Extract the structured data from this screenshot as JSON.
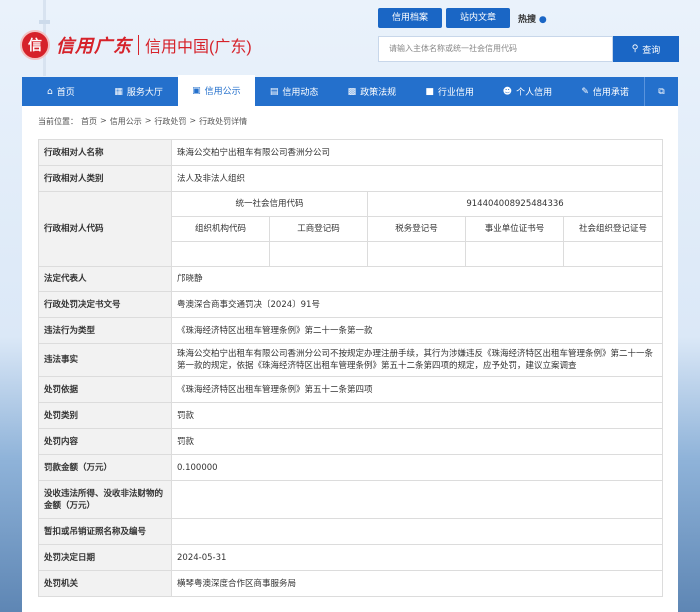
{
  "header": {
    "logo_mark": "信",
    "logo_calligraphy": "信用广东",
    "logo_title": "信用中国(广东)",
    "search_tabs": [
      "信用档案",
      "站内文章"
    ],
    "hotword_label": "热搜",
    "hotword_icon": "flame-icon",
    "search_placeholder": "请输入主体名称或统一社会信用代码",
    "search_button": "查询"
  },
  "nav": {
    "items": [
      {
        "label": "首页",
        "icon": "home-icon"
      },
      {
        "label": "服务大厅",
        "icon": "grid-icon"
      },
      {
        "label": "信用公示",
        "icon": "bag-icon"
      },
      {
        "label": "信用动态",
        "icon": "document-icon"
      },
      {
        "label": "政策法规",
        "icon": "book-icon"
      },
      {
        "label": "行业信用",
        "icon": "briefcase-icon"
      },
      {
        "label": "个人信用",
        "icon": "person-icon"
      },
      {
        "label": "信用承诺",
        "icon": "pen-icon"
      }
    ],
    "active_index": 2,
    "expand_icon": "expand-icon"
  },
  "breadcrumb": {
    "prefix": "当前位置：",
    "items": [
      "首页",
      "信用公示",
      "行政处罚",
      "行政处罚详情"
    ],
    "separator": ">"
  },
  "detail": {
    "name_label": "行政相对人名称",
    "name_value": "珠海公交柏宁出租车有限公司香洲分公司",
    "category_label": "行政相对人类别",
    "category_value": "法人及非法人组织",
    "code_label": "行政相对人代码",
    "uscc_label": "统一社会信用代码",
    "uscc_value": "914404008925484336",
    "sub_code_headers": [
      "组织机构代码",
      "工商登记码",
      "税务登记号",
      "事业单位证书号",
      "社会组织登记证号"
    ],
    "legal_rep_label": "法定代表人",
    "legal_rep_value": "邝晓静",
    "doc_no_label": "行政处罚决定书文号",
    "doc_no_value": "粤澳深合商事交通罚决〔2024〕91号",
    "violation_type_label": "违法行为类型",
    "violation_type_value": "《珠海经济特区出租车管理条例》第二十一条第一款",
    "facts_label": "违法事实",
    "facts_value": "珠海公交柏宁出租车有限公司香洲分公司不按规定办理注册手续，其行为涉嫌违反《珠海经济特区出租车管理条例》第二十一条第一款的规定，依据《珠海经济特区出租车管理条例》第五十二条第四项的规定，应予处罚，建议立案调查",
    "basis_label": "处罚依据",
    "basis_value": "《珠海经济特区出租车管理条例》第五十二条第四项",
    "penalty_type_label": "处罚类别",
    "penalty_type_value": "罚款",
    "penalty_content_label": "处罚内容",
    "penalty_content_value": "罚款",
    "amount_label": "罚款金额（万元）",
    "amount_value": "0.100000",
    "confiscation_label": "没收违法所得、没收非法财物的金额（万元）",
    "confiscation_value": "",
    "suspend_label": "暂扣或吊销证照名称及编号",
    "suspend_value": "",
    "date_label": "处罚决定日期",
    "date_value": "2024-05-31",
    "authority_label": "处罚机关",
    "authority_value": "横琴粤澳深度合作区商事服务局"
  }
}
